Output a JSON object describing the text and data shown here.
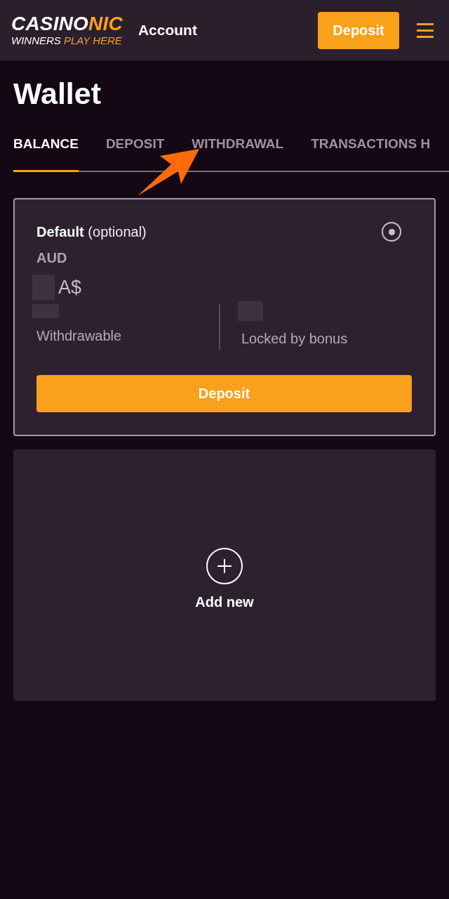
{
  "header": {
    "logo": {
      "wordmark": [
        {
          "text": "CASINO",
          "accent": false
        },
        {
          "text": "NIC",
          "accent": true
        }
      ],
      "tagline": [
        {
          "text": "WINNERS",
          "accent": false
        },
        {
          "text": "PLAY HERE",
          "accent": true
        }
      ]
    },
    "title": "Account",
    "deposit_button": "Deposit"
  },
  "page": {
    "title": "Wallet"
  },
  "tabs": [
    {
      "label": "BALANCE",
      "selected": true
    },
    {
      "label": "DEPOSIT",
      "selected": false
    },
    {
      "label": "WITHDRAWAL",
      "selected": false
    },
    {
      "label": "TRANSACTIONS H",
      "selected": false
    }
  ],
  "wallets": [
    {
      "name": "**Default** (optional)",
      "selected": true,
      "currency": "AUD",
      "symbol": "A$",
      "balances": [
        {
          "label": "Withdrawable"
        },
        {
          "label": "Locked by bonus"
        }
      ],
      "button": "Deposit"
    }
  ],
  "add_new": {
    "label": "Add new"
  }
}
